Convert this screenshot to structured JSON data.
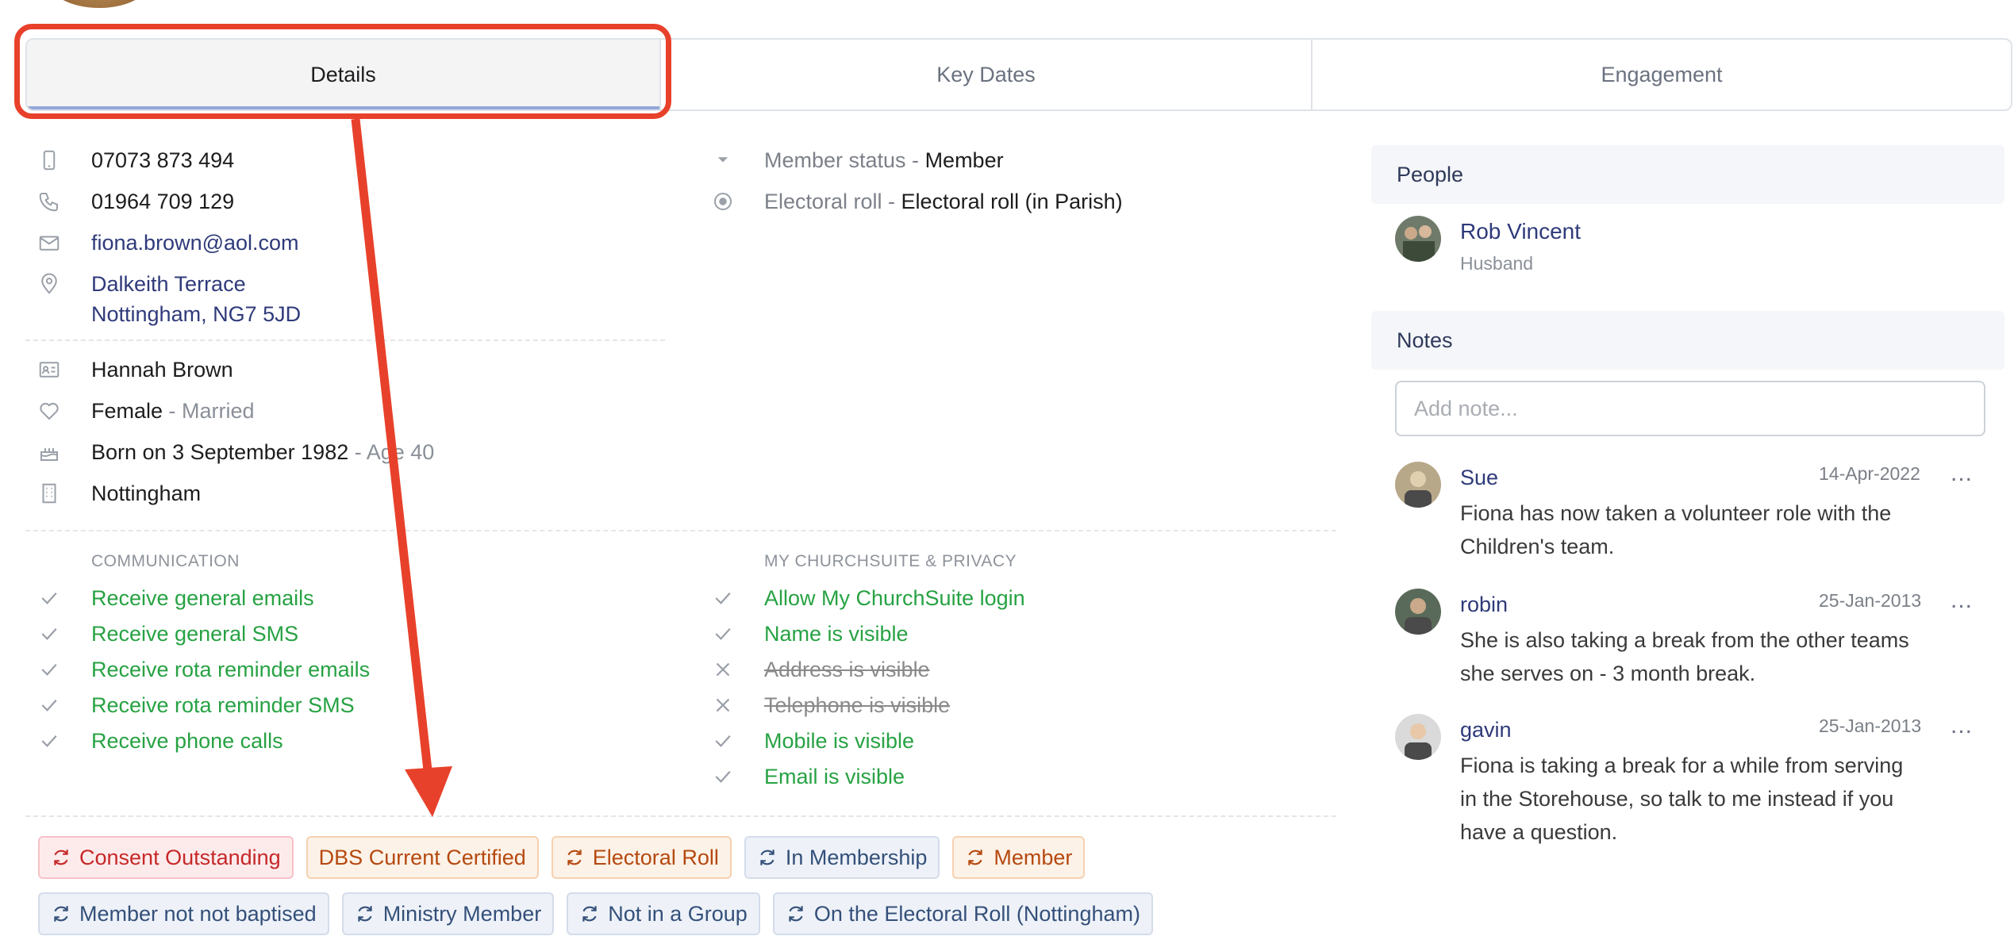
{
  "tabs": [
    {
      "label": "Details"
    },
    {
      "label": "Key Dates"
    },
    {
      "label": "Engagement"
    }
  ],
  "contact": {
    "mobile": "07073 873 494",
    "phone": "01964 709 129",
    "email": "fiona.brown@aol.com",
    "address_line1": "Dalkeith Terrace",
    "address_line2": "Nottingham, NG7 5JD",
    "name": "Hannah Brown",
    "gender": "Female",
    "marital": " - Married",
    "birth": "Born on 3 September 1982",
    "age": " - Age 40",
    "site": "Nottingham"
  },
  "membership": {
    "status_label": "Member status - ",
    "status_value": "Member",
    "roll_label": "Electoral roll - ",
    "roll_value": "Electoral roll (in Parish)"
  },
  "communication": {
    "heading": "COMMUNICATION",
    "items": [
      "Receive general emails",
      "Receive general SMS",
      "Receive rota reminder emails",
      "Receive rota reminder SMS",
      "Receive phone calls"
    ]
  },
  "privacy": {
    "heading": "MY CHURCHSUITE & PRIVACY",
    "items": [
      {
        "label": "Allow My ChurchSuite login",
        "enabled": true
      },
      {
        "label": "Name is visible",
        "enabled": true
      },
      {
        "label": "Address is visible",
        "enabled": false
      },
      {
        "label": "Telephone is visible",
        "enabled": false
      },
      {
        "label": "Mobile is visible",
        "enabled": true
      },
      {
        "label": "Email is visible",
        "enabled": true
      }
    ]
  },
  "tags": [
    {
      "label": "Consent Outstanding",
      "color": "red",
      "icon": "refresh-icon"
    },
    {
      "label": "DBS Current Certified",
      "color": "orange",
      "icon": ""
    },
    {
      "label": "Electoral Roll",
      "color": "orange",
      "icon": "refresh-icon"
    },
    {
      "label": "In Membership",
      "color": "blue",
      "icon": "refresh-icon"
    },
    {
      "label": "Member",
      "color": "orange",
      "icon": "refresh-icon"
    },
    {
      "label": "Member not not baptised",
      "color": "blue",
      "icon": "refresh-icon"
    },
    {
      "label": "Ministry Member",
      "color": "blue",
      "icon": "refresh-icon"
    },
    {
      "label": "Not in a Group",
      "color": "blue",
      "icon": "refresh-icon"
    },
    {
      "label": "On the Electoral Roll (Nottingham)",
      "color": "blue",
      "icon": "refresh-icon"
    }
  ],
  "people": {
    "heading": "People",
    "items": [
      {
        "name": "Rob Vincent",
        "relation": "Husband"
      }
    ]
  },
  "notes": {
    "heading": "Notes",
    "placeholder": "Add note...",
    "items": [
      {
        "author": "Sue",
        "date": "14-Apr-2022",
        "line1": "Fiona has now taken a volunteer role with the",
        "line2": "Children's team.",
        "line3": ""
      },
      {
        "author": "robin",
        "date": "25-Jan-2013",
        "line1": "She is also taking a break from the other teams",
        "line2": "she serves on - 3 month break.",
        "line3": ""
      },
      {
        "author": "gavin",
        "date": "25-Jan-2013",
        "line1": "Fiona is taking a break for a while from serving",
        "line2": "in the Storehouse, so talk to me instead if you",
        "line3": "have a question."
      }
    ],
    "more_label": "..."
  },
  "colors": {
    "accent_red": "#e8412b",
    "check_green": "#27a243",
    "link_blue": "#2f3a7a"
  }
}
